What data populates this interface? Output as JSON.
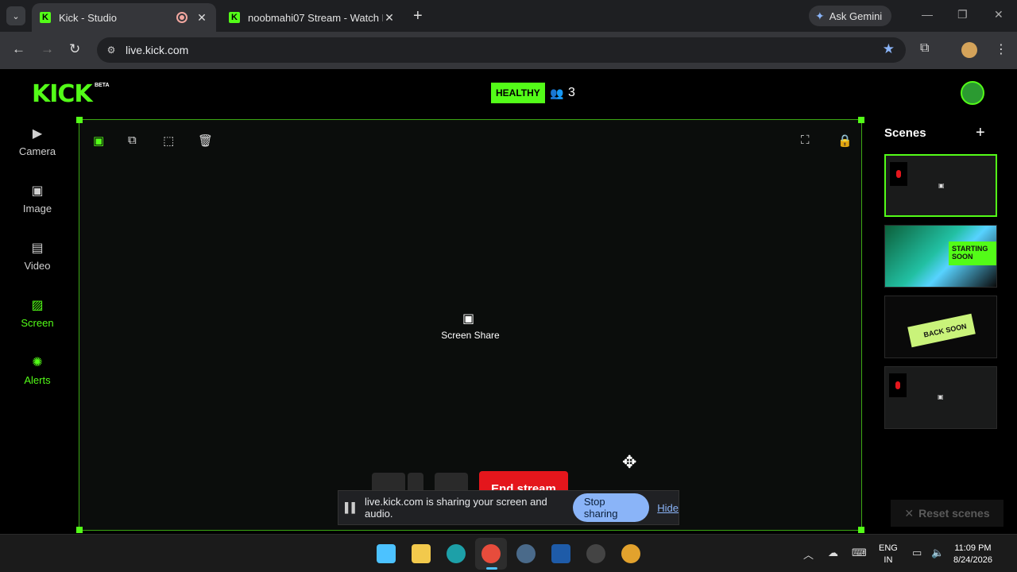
{
  "browser": {
    "tabs": [
      {
        "title": "Kick - Studio",
        "active": true
      },
      {
        "title": "noobmahi07 Stream - Watch Li",
        "active": false
      }
    ],
    "new_tab": "+",
    "ask_gemini": "Ask Gemini",
    "url": "live.kick.com",
    "window_controls": [
      "minimize-icon",
      "restore-icon",
      "close-icon"
    ]
  },
  "header": {
    "logo": "KICK",
    "beta": "BETA",
    "health": "HEALTHY",
    "viewer_count": "3"
  },
  "sidebar": {
    "items": [
      {
        "label": "Camera",
        "icon": "camera-icon"
      },
      {
        "label": "Image",
        "icon": "image-icon"
      },
      {
        "label": "Video",
        "icon": "video-icon"
      },
      {
        "label": "Screen",
        "icon": "screen-icon"
      },
      {
        "label": "Alerts",
        "icon": "alerts-icon"
      }
    ]
  },
  "canvas": {
    "source_label": "Screen Share",
    "end_stream": "End stream",
    "accent": "#53fc18"
  },
  "share_bar": {
    "message": "live.kick.com is sharing your screen and audio.",
    "stop": "Stop sharing",
    "hide": "Hide"
  },
  "scenes": {
    "title": "Scenes",
    "items": [
      {
        "label": ""
      },
      {
        "label": "STARTING SOON"
      },
      {
        "label": "BACK SOON"
      },
      {
        "label": ""
      }
    ],
    "reset": "Reset scenes"
  },
  "taskbar": {
    "lang_line1": "ENG",
    "lang_line2": "IN",
    "time": "11:09 PM",
    "date": "8/24/2026"
  }
}
